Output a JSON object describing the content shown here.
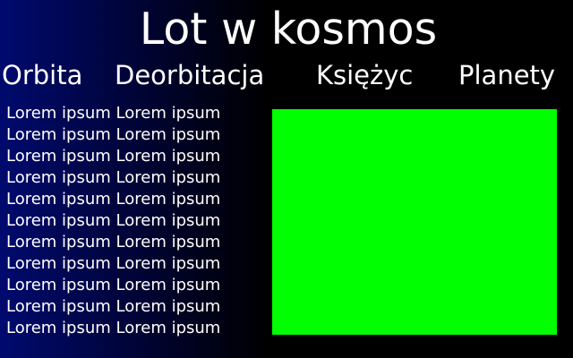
{
  "title": "Lot w kosmos",
  "nav": [
    "Orbita",
    "Deorbitacja",
    "Księżyc",
    "Planety"
  ],
  "lines": [
    "Lorem ipsum Lorem ipsum",
    "Lorem ipsum Lorem ipsum",
    "Lorem ipsum Lorem ipsum",
    "Lorem ipsum Lorem ipsum",
    "Lorem ipsum Lorem ipsum",
    "Lorem ipsum Lorem ipsum",
    "Lorem ipsum Lorem ipsum",
    "Lorem ipsum Lorem ipsum",
    "Lorem ipsum Lorem ipsum",
    "Lorem ipsum Lorem ipsum",
    "Lorem ipsum Lorem ipsum"
  ],
  "colors": {
    "background_left": "#000a6e",
    "background_right": "#000000",
    "text": "#ffffff",
    "panel": "#00ff00"
  }
}
